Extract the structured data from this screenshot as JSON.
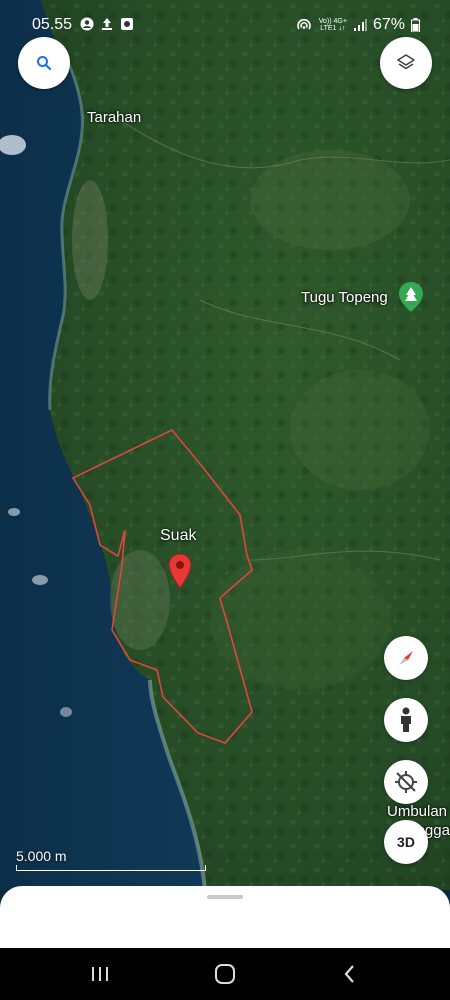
{
  "status_bar": {
    "time": "05.55",
    "network_top": "Vo)) 4G+",
    "network_bottom": "LTE1 ↓↑",
    "battery": "67%"
  },
  "map": {
    "labels": {
      "tarahan": "Tarahan",
      "tugu_topeng": "Tugu Topeng",
      "suak": "Suak",
      "umbulan": "Umbulan",
      "umbulan_cut": "P...ngga"
    },
    "boundary_color": "#e0463d",
    "pin_color": "#e53935",
    "poi_color": "#34a853",
    "scale_label": "5.000 m"
  },
  "controls": {
    "search_icon": "search-icon",
    "layers_icon": "layers-icon",
    "compass_icon": "compass-icon",
    "pegman_icon": "pegman-icon",
    "recenter_icon": "location-off-icon",
    "btn_3d_label": "3D"
  },
  "navbar": {
    "recents_icon": "recents-icon",
    "home_icon": "home-icon",
    "back_icon": "back-icon"
  }
}
